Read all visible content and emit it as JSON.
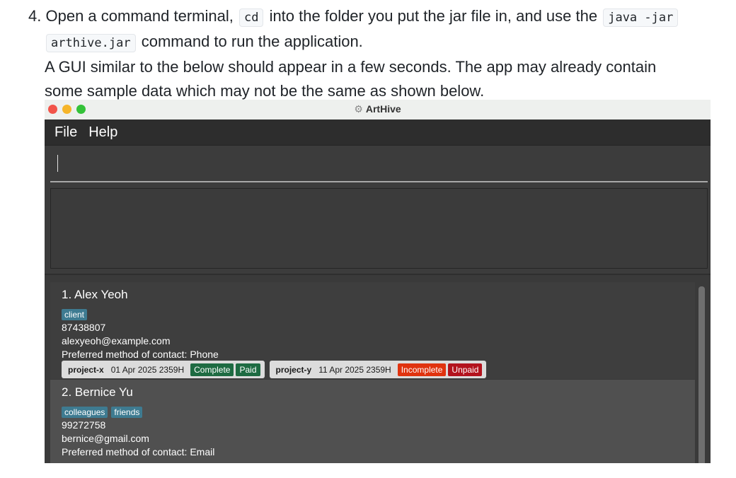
{
  "step": {
    "number": "4.",
    "line1_pre": "Open a command terminal,",
    "line1_code1": "cd",
    "line1_mid": "into the folder you put the jar file in, and use the",
    "line1_code2": "java -jar",
    "line2_code": "arthive.jar",
    "line2_post": "command to run the application.",
    "line3": "A GUI similar to the below should appear in a few seconds. The app may already contain",
    "line4": "some sample data which may not be the same as shown below."
  },
  "window": {
    "title": "ArtHive",
    "menu": [
      "File",
      "Help"
    ],
    "command_value": "",
    "result_text": ""
  },
  "persons": [
    {
      "name": "1. Alex Yeoh",
      "tags": [
        "client"
      ],
      "phone": "87438807",
      "email": "alexyeoh@example.com",
      "preferred": "Preferred method of contact: Phone",
      "projects": [
        {
          "name": "project-x",
          "deadline": "01 Apr 2025 2359H",
          "status": "Complete",
          "payment": "Paid"
        },
        {
          "name": "project-y",
          "deadline": "11 Apr 2025 2359H",
          "status": "Incomplete",
          "payment": "Unpaid"
        }
      ]
    },
    {
      "name": "2. Bernice Yu",
      "tags": [
        "colleagues",
        "friends"
      ],
      "phone": "99272758",
      "email": "bernice@gmail.com",
      "preferred": "Preferred method of contact: Email",
      "projects": []
    }
  ],
  "colors": {
    "tag": "#3e7b91",
    "complete": "#1e6b42",
    "paid": "#1e6b42",
    "incomplete": "#e0330f",
    "unpaid": "#b3131d"
  }
}
